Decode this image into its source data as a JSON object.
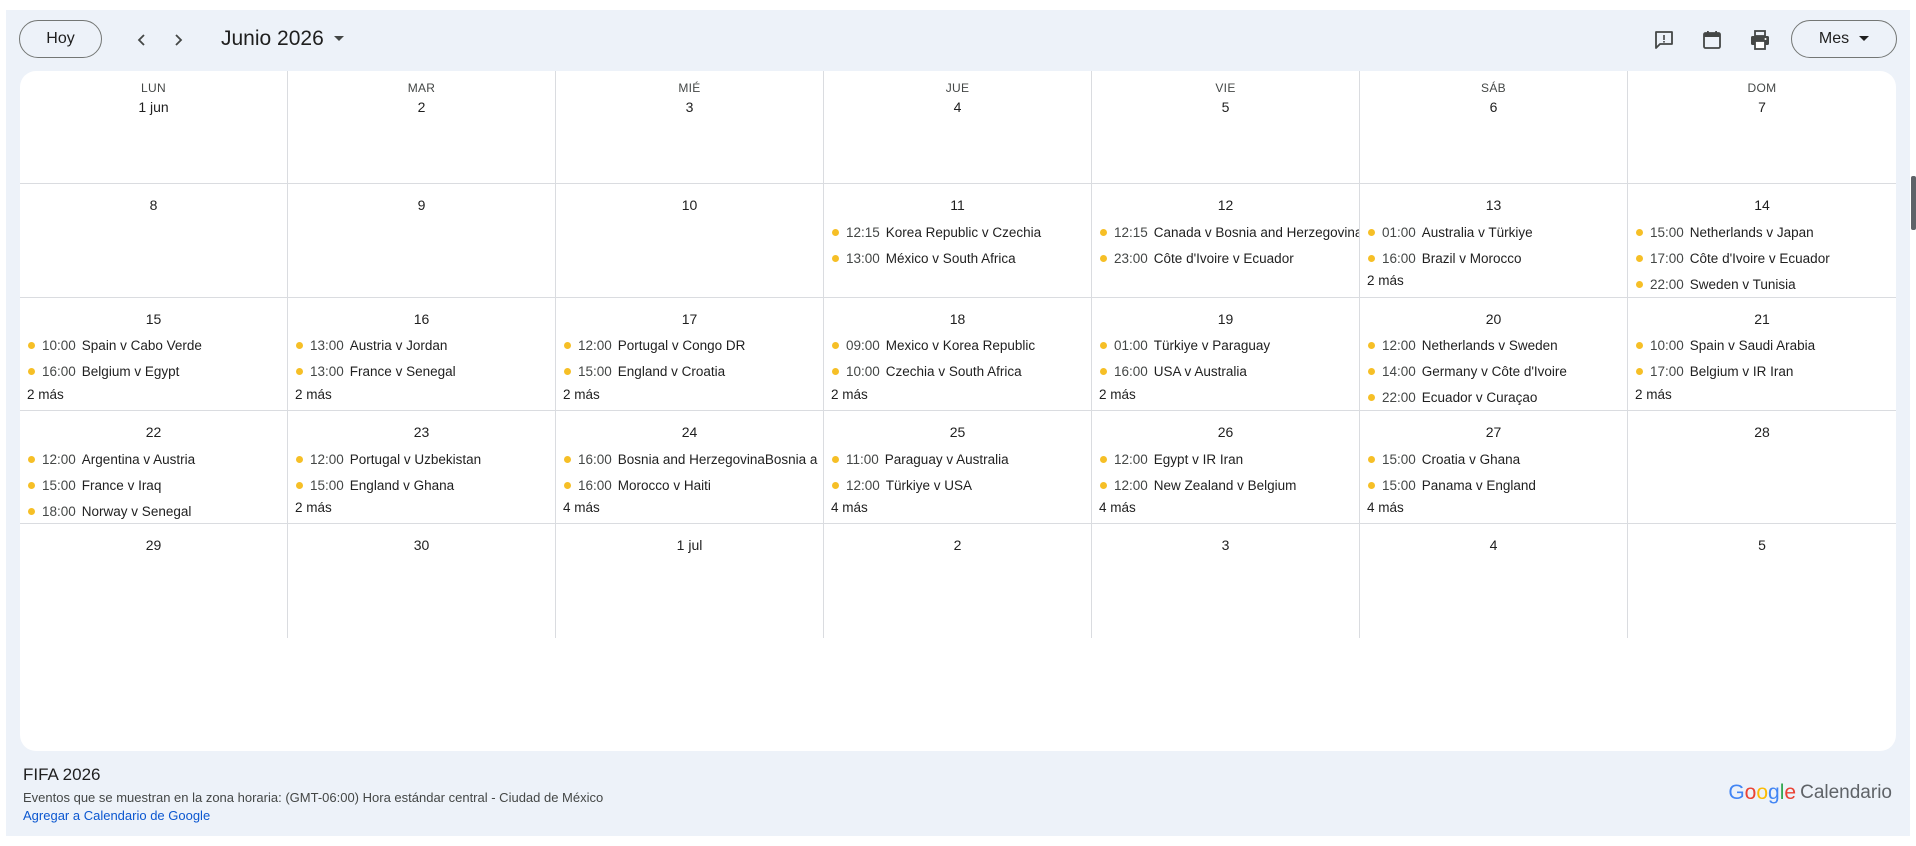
{
  "toolbar": {
    "today_label": "Hoy",
    "month_title": "Junio 2026",
    "view_label": "Mes",
    "icons": [
      "feedback-icon",
      "calendar-icon",
      "print-icon"
    ]
  },
  "weekday_headers": [
    "LUN",
    "MAR",
    "MIÉ",
    "JUE",
    "VIE",
    "SÁB",
    "DOM"
  ],
  "weeks": [
    [
      {
        "day": "1 jun",
        "events": [],
        "more": ""
      },
      {
        "day": "2",
        "events": [],
        "more": ""
      },
      {
        "day": "3",
        "events": [],
        "more": ""
      },
      {
        "day": "4",
        "events": [],
        "more": ""
      },
      {
        "day": "5",
        "events": [],
        "more": ""
      },
      {
        "day": "6",
        "events": [],
        "more": ""
      },
      {
        "day": "7",
        "events": [],
        "more": ""
      }
    ],
    [
      {
        "day": "8",
        "events": [],
        "more": ""
      },
      {
        "day": "9",
        "events": [],
        "more": ""
      },
      {
        "day": "10",
        "events": [],
        "more": ""
      },
      {
        "day": "11",
        "events": [
          {
            "time": "12:15",
            "title": "Korea Republic v Czechia"
          },
          {
            "time": "13:00",
            "title": "México v South Africa"
          }
        ],
        "more": ""
      },
      {
        "day": "12",
        "events": [
          {
            "time": "12:15",
            "title": "Canada v Bosnia and Herzegovina"
          },
          {
            "time": "23:00",
            "title": "Côte d'Ivoire v Ecuador"
          }
        ],
        "more": ""
      },
      {
        "day": "13",
        "events": [
          {
            "time": "01:00",
            "title": "Australia v Türkiye"
          },
          {
            "time": "16:00",
            "title": "Brazil v Morocco"
          }
        ],
        "more": "2 más"
      },
      {
        "day": "14",
        "events": [
          {
            "time": "15:00",
            "title": "Netherlands v Japan"
          },
          {
            "time": "17:00",
            "title": "Côte d'Ivoire v Ecuador"
          },
          {
            "time": "22:00",
            "title": "Sweden v Tunisia"
          }
        ],
        "more": ""
      }
    ],
    [
      {
        "day": "15",
        "events": [
          {
            "time": "10:00",
            "title": "Spain v Cabo Verde"
          },
          {
            "time": "16:00",
            "title": "Belgium v Egypt"
          }
        ],
        "more": "2 más"
      },
      {
        "day": "16",
        "events": [
          {
            "time": "13:00",
            "title": "Austria v Jordan"
          },
          {
            "time": "13:00",
            "title": "France v Senegal"
          }
        ],
        "more": "2 más"
      },
      {
        "day": "17",
        "events": [
          {
            "time": "12:00",
            "title": "Portugal v Congo DR"
          },
          {
            "time": "15:00",
            "title": "England v Croatia"
          }
        ],
        "more": "2 más"
      },
      {
        "day": "18",
        "events": [
          {
            "time": "09:00",
            "title": "Mexico v Korea Republic"
          },
          {
            "time": "10:00",
            "title": "Czechia v South Africa"
          }
        ],
        "more": "2 más"
      },
      {
        "day": "19",
        "events": [
          {
            "time": "01:00",
            "title": "Türkiye v Paraguay"
          },
          {
            "time": "16:00",
            "title": "USA v Australia"
          }
        ],
        "more": "2 más"
      },
      {
        "day": "20",
        "events": [
          {
            "time": "12:00",
            "title": "Netherlands v Sweden"
          },
          {
            "time": "14:00",
            "title": "Germany v Côte d'Ivoire"
          },
          {
            "time": "22:00",
            "title": "Ecuador v Curaçao"
          }
        ],
        "more": ""
      },
      {
        "day": "21",
        "events": [
          {
            "time": "10:00",
            "title": "Spain v Saudi Arabia"
          },
          {
            "time": "17:00",
            "title": "Belgium v IR Iran"
          }
        ],
        "more": "2 más"
      }
    ],
    [
      {
        "day": "22",
        "events": [
          {
            "time": "12:00",
            "title": "Argentina v Austria"
          },
          {
            "time": "15:00",
            "title": "France v Iraq"
          },
          {
            "time": "18:00",
            "title": "Norway v Senegal"
          }
        ],
        "more": ""
      },
      {
        "day": "23",
        "events": [
          {
            "time": "12:00",
            "title": "Portugal v Uzbekistan"
          },
          {
            "time": "15:00",
            "title": "England v Ghana"
          }
        ],
        "more": "2 más"
      },
      {
        "day": "24",
        "events": [
          {
            "time": "16:00",
            "title": "Bosnia and HerzegovinaBosnia a"
          },
          {
            "time": "16:00",
            "title": "Morocco v Haiti"
          }
        ],
        "more": "4 más"
      },
      {
        "day": "25",
        "events": [
          {
            "time": "11:00",
            "title": "Paraguay v Australia"
          },
          {
            "time": "12:00",
            "title": "Türkiye v USA"
          }
        ],
        "more": "4 más"
      },
      {
        "day": "26",
        "events": [
          {
            "time": "12:00",
            "title": "Egypt v IR Iran"
          },
          {
            "time": "12:00",
            "title": "New Zealand v Belgium"
          }
        ],
        "more": "4 más"
      },
      {
        "day": "27",
        "events": [
          {
            "time": "15:00",
            "title": "Croatia v Ghana"
          },
          {
            "time": "15:00",
            "title": "Panama v England"
          }
        ],
        "more": "4 más"
      },
      {
        "day": "28",
        "events": [],
        "more": ""
      }
    ],
    [
      {
        "day": "29",
        "events": [],
        "more": ""
      },
      {
        "day": "30",
        "events": [],
        "more": ""
      },
      {
        "day": "1 jul",
        "events": [],
        "more": ""
      },
      {
        "day": "2",
        "events": [],
        "more": ""
      },
      {
        "day": "3",
        "events": [],
        "more": ""
      },
      {
        "day": "4",
        "events": [],
        "more": ""
      },
      {
        "day": "5",
        "events": [],
        "more": ""
      }
    ]
  ],
  "footer": {
    "calendar_name": "FIFA 2026",
    "timezone_note": "Eventos que se muestran en la zona horaria: (GMT-06:00) Hora estándar central - Ciudad de México",
    "add_link": "Agregar a Calendario de Google",
    "brand_google": "Google",
    "brand_product": "Calendario"
  },
  "colors": {
    "event_dot": "#f6bf26",
    "link": "#0b57d0",
    "background": "#edf2f9"
  }
}
